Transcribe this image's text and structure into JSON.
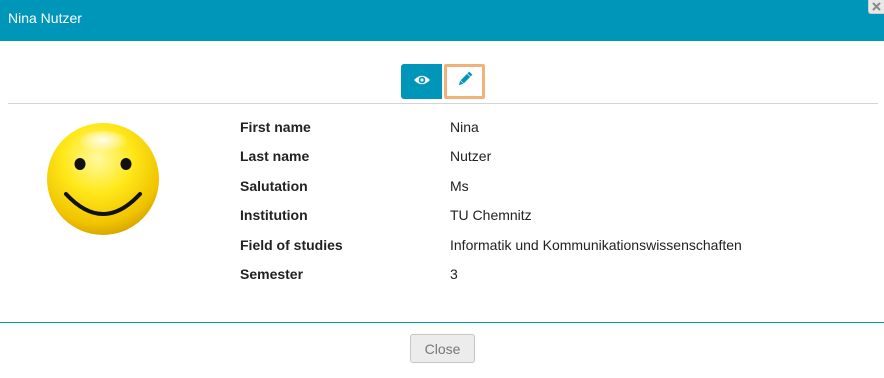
{
  "dialog": {
    "title": "Nina Nutzer",
    "close_x_icon": "close-icon"
  },
  "toolbar": {
    "view_icon": "eye-icon",
    "edit_icon": "pencil-icon",
    "accent_color": "#0096b9",
    "highlight_color": "#f0b27a"
  },
  "profile": {
    "avatar_icon": "smiley-icon",
    "fields": [
      {
        "label": "First name",
        "value": "Nina"
      },
      {
        "label": "Last name",
        "value": "Nutzer"
      },
      {
        "label": "Salutation",
        "value": "Ms"
      },
      {
        "label": "Institution",
        "value": "TU Chemnitz"
      },
      {
        "label": "Field of studies",
        "value": "Informatik und Kommunikationswissenschaften"
      },
      {
        "label": "Semester",
        "value": "3"
      }
    ]
  },
  "footer": {
    "close_label": "Close"
  }
}
